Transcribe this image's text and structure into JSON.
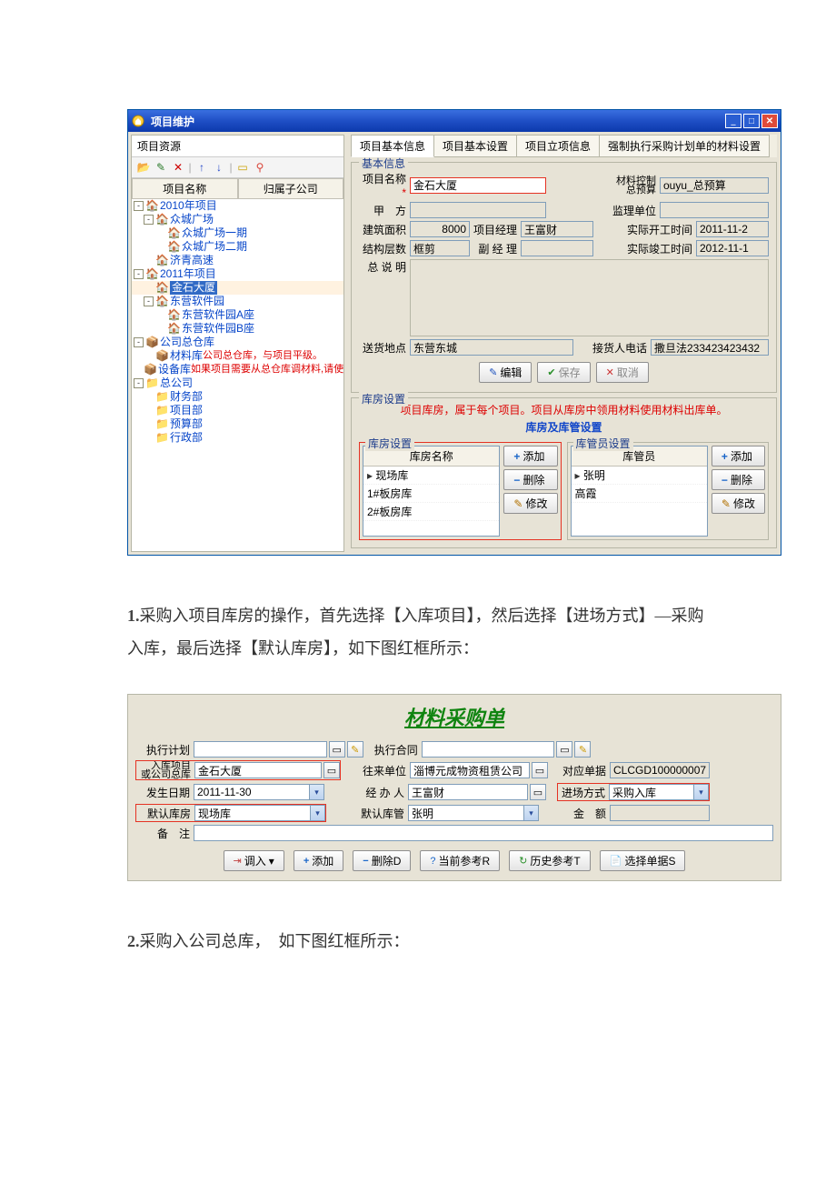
{
  "win1": {
    "title": "项目维护",
    "left_header": "项目资源",
    "col_name": "项目名称",
    "col_sub": "归属子公司",
    "tree": [
      {
        "indent": 0,
        "tog": "-",
        "ico": "🏠",
        "label": "2010年项目",
        "cls": "bluetxt"
      },
      {
        "indent": 1,
        "tog": "-",
        "ico": "🏠",
        "label": "众城广场",
        "cls": "bluetxt"
      },
      {
        "indent": 2,
        "tog": "",
        "ico": "🏠",
        "label": "众城广场一期",
        "cls": "bluetxt"
      },
      {
        "indent": 2,
        "tog": "",
        "ico": "🏠",
        "label": "众城广场二期",
        "cls": "bluetxt"
      },
      {
        "indent": 1,
        "tog": "",
        "ico": "🏠",
        "label": "济青高速",
        "cls": "bluetxt"
      },
      {
        "indent": 0,
        "tog": "-",
        "ico": "🏠",
        "label": "2011年项目",
        "cls": "bluetxt"
      },
      {
        "indent": 1,
        "tog": "",
        "ico": "🏠",
        "label": "金石大厦",
        "cls": "",
        "sel": true
      },
      {
        "indent": 1,
        "tog": "-",
        "ico": "🏠",
        "label": "东营软件园",
        "cls": "bluetxt"
      },
      {
        "indent": 2,
        "tog": "",
        "ico": "🏠",
        "label": "东营软件园A座",
        "cls": "bluetxt"
      },
      {
        "indent": 2,
        "tog": "",
        "ico": "🏠",
        "label": "东营软件园B座",
        "cls": "bluetxt"
      },
      {
        "indent": 0,
        "tog": "-",
        "ico": "📦",
        "label": "公司总仓库",
        "cls": "bluetxt"
      },
      {
        "indent": 1,
        "tog": "",
        "ico": "📦",
        "label": "材料库",
        "red": "公司总仓库，与项目平级。",
        "cls": "bluetxt"
      },
      {
        "indent": 1,
        "tog": "",
        "ico": "📦",
        "label": "设备库",
        "red": "如果项目需要从总仓库调材料,请使用材料调拨单。",
        "cls": "bluetxt"
      },
      {
        "indent": 0,
        "tog": "-",
        "ico": "📁",
        "label": "总公司",
        "cls": "bluetxt"
      },
      {
        "indent": 1,
        "tog": "",
        "ico": "📁",
        "label": "财务部",
        "cls": "bluetxt"
      },
      {
        "indent": 1,
        "tog": "",
        "ico": "📁",
        "label": "项目部",
        "cls": "bluetxt"
      },
      {
        "indent": 1,
        "tog": "",
        "ico": "📁",
        "label": "预算部",
        "cls": "bluetxt"
      },
      {
        "indent": 1,
        "tog": "",
        "ico": "📁",
        "label": "行政部",
        "cls": "bluetxt"
      }
    ],
    "tabs": [
      "项目基本信息",
      "项目基本设置",
      "项目立项信息",
      "强制执行采购计划单的材料设置"
    ],
    "basic_legend": "基本信息",
    "f_project_label": "项目名称",
    "f_project_val": "金石大厦",
    "f_matctrl_label": "材料控制\n总预算",
    "f_matctrl_val": "ouyu_总预算",
    "f_jia_label": "甲　方",
    "f_super_label": "监理单位",
    "f_area_label": "建筑面积",
    "f_area_val": "8000",
    "f_mgr_label": "项目经理",
    "f_mgr_val": "王富财",
    "f_start_label": "实际开工时间",
    "f_start_val": "2011-11-2",
    "f_floor_label": "结构层数",
    "f_floor_val": "框剪",
    "f_vice_label": "副 经 理",
    "f_end_label": "实际竣工时间",
    "f_end_val": "2012-11-1",
    "f_desc_label": "总 说 明",
    "f_addr_label": "送货地点",
    "f_addr_val": "东营东城",
    "f_phone_label": "接货人电话",
    "f_phone_val": "撒旦法233423423432",
    "b_edit": "编辑",
    "b_save": "保存",
    "b_cancel": "取消",
    "wh_legend": "库房设置",
    "wh_note": "项目库房，属于每个项目。项目从库房中领用材料使用材料出库单。",
    "wh_sub": "库房及库管设置",
    "whroom_legend": "库房设置",
    "whroom_head": "库房名称",
    "whroom_rows": [
      "现场库",
      "1#板房库",
      "2#板房库"
    ],
    "whmgr_legend": "库管员设置",
    "whmgr_head": "库管员",
    "whmgr_rows": [
      "张明",
      "高霞"
    ],
    "b_add": "添加",
    "b_del": "删除",
    "b_mod": "修改"
  },
  "doc_p1": "采购入项目库房的操作，首先选择【入库项目】，然后选择【进场方式】—采购入库，最后选择【默认库房】，如下图红框所示：",
  "doc_p1_num": "1.",
  "form2": {
    "title": "材料采购单",
    "l_plan": "执行计划",
    "l_contract": "执行合同",
    "l_proj": "入库项目\n或公司总库",
    "v_proj": "金石大厦",
    "l_from": "往来单位",
    "v_from": "淄博元成物资租赁公司",
    "l_doc": "对应单据",
    "v_doc": "CLCGD100000007",
    "l_date": "发生日期",
    "v_date": "2011-11-30",
    "l_handler": "经 办 人",
    "v_handler": "王富财",
    "l_mode": "进场方式",
    "v_mode": "采购入库",
    "l_defwh": "默认库房",
    "v_defwh": "现场库",
    "l_defmgr": "默认库管",
    "v_defmgr": "张明",
    "l_amount": "金　额",
    "l_remark": "备　注",
    "b_diao": "调入",
    "b_add": "添加",
    "b_del": "删除D",
    "b_curref": "当前参考R",
    "b_hisref": "历史参考T",
    "b_seldoc": "选择单据S"
  },
  "doc_p2": "采购入公司总库，　如下图红框所示：",
  "doc_p2_num": "2."
}
